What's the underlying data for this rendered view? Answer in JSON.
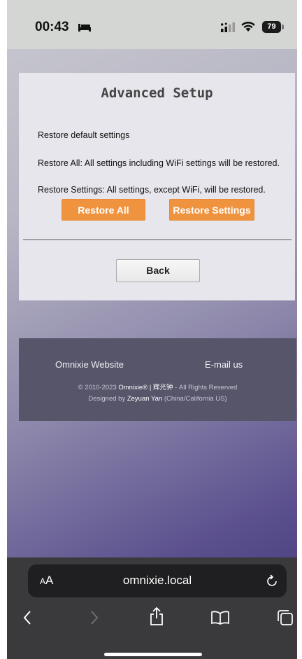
{
  "status": {
    "time": "00:43",
    "battery": "79"
  },
  "card": {
    "title": "Advanced Setup",
    "line1": "Restore default settings",
    "line2": "Restore All: All settings including WiFi settings will be restored.",
    "line3": "Restore Settings: All settings, except WiFi, will be restored.",
    "restore_all": "Restore All",
    "restore_settings": "Restore Settings",
    "back": "Back"
  },
  "footer": {
    "website": "Omnixie Website",
    "email": "E-mail us",
    "copy_prefix": "© 2010-2023",
    "brand": "Omnixie® | 辉光钟",
    "copy_suffix": "- All Rights Reserved",
    "designed_by": "Designed by",
    "designer": "Zeyuan Yan",
    "designer_loc": "(China/California US)"
  },
  "browser": {
    "aa_small": "A",
    "aa_large": "A",
    "url": "omnixie.local"
  }
}
